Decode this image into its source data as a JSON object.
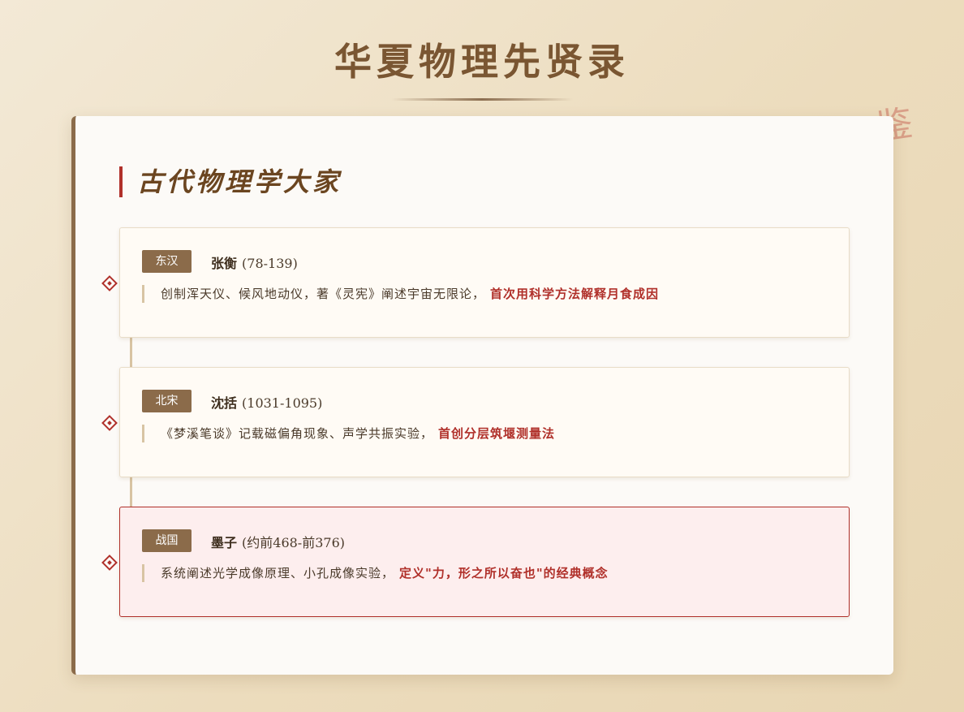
{
  "page": {
    "title": "华夏物理先贤录",
    "seal_char": "鉴"
  },
  "section": {
    "title": "古代物理学大家",
    "entries": [
      {
        "era": "东汉",
        "name": "张衡",
        "years": "(78-139)",
        "description": "创制浑天仪、候风地动仪，著《灵宪》阐述宇宙无限论，",
        "highlight": "首次用科学方法解释月食成因"
      },
      {
        "era": "北宋",
        "name": "沈括",
        "years": "(1031-1095)",
        "description": "《梦溪笔谈》记载磁偏角现象、声学共振实验，",
        "highlight": "首创分层筑堰测量法"
      },
      {
        "era": "战国",
        "name": "墨子",
        "years": "(约前468-前376)",
        "description": "系统阐述光学成像原理、小孔成像实验，",
        "highlight": "定义\"力，形之所以奋也\"的经典概念"
      }
    ]
  },
  "colors": {
    "accent": "#b0302a",
    "brown": "#8b6b4a",
    "title": "#7a5632"
  }
}
